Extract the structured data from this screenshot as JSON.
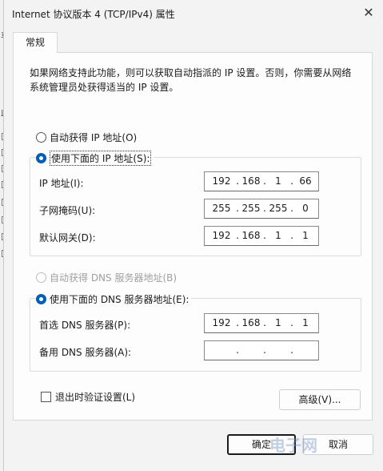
{
  "window": {
    "title": "Internet 协议版本 4 (TCP/IPv4) 属性",
    "close_glyph": "✕"
  },
  "tabs": [
    {
      "label": "常规"
    }
  ],
  "description": "如果网络支持此功能，则可以获取自动指派的 IP 设置。否则，你需要从网络系统管理员处获得适当的 IP 设置。",
  "ip_section": {
    "auto_label": "自动获得 IP 地址(O)",
    "manual_label": "使用下面的 IP 地址(S):",
    "selected": "manual",
    "fields": [
      {
        "label": "IP 地址(I):",
        "octets": [
          "192",
          "168",
          "1",
          "66"
        ]
      },
      {
        "label": "子网掩码(U):",
        "octets": [
          "255",
          "255",
          "255",
          "0"
        ]
      },
      {
        "label": "默认网关(D):",
        "octets": [
          "192",
          "168",
          "1",
          "1"
        ]
      }
    ]
  },
  "dns_section": {
    "auto_label": "自动获得 DNS 服务器地址(B)",
    "auto_disabled": true,
    "manual_label": "使用下面的 DNS 服务器地址(E):",
    "selected": "manual",
    "fields": [
      {
        "label": "首选 DNS 服务器(P):",
        "octets": [
          "192",
          "168",
          "1",
          "1"
        ]
      },
      {
        "label": "备用 DNS 服务器(A):",
        "octets": [
          "",
          "",
          "",
          ""
        ]
      }
    ]
  },
  "validate_checkbox": {
    "label": "退出时验证设置(L)",
    "checked": false
  },
  "buttons": {
    "advanced": "高级(V)...",
    "ok": "确定",
    "cancel": "取消"
  },
  "watermark": "电子网",
  "background_window": {
    "texts": [
      "连",
      "车",
      "此"
    ]
  },
  "colors": {
    "accent": "#005fb8"
  }
}
